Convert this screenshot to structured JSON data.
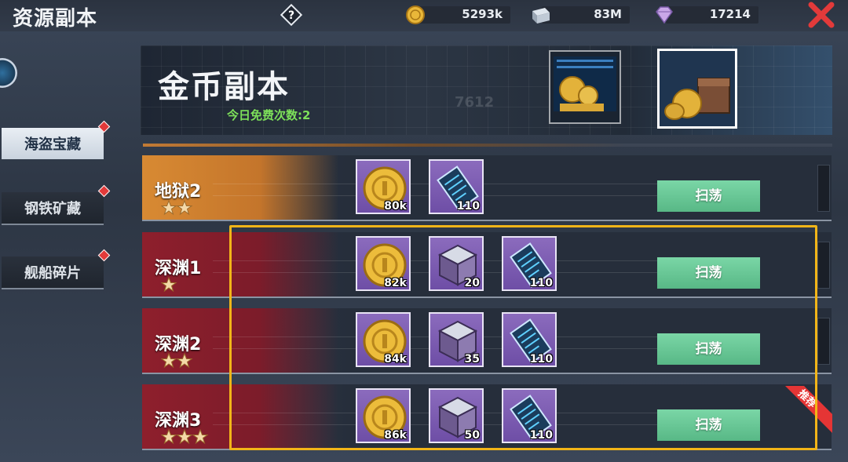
{
  "header": {
    "title": "资源副本",
    "help_icon": "question-diamond-icon",
    "resources": [
      {
        "icon": "gold-coin-icon",
        "value": "5293k"
      },
      {
        "icon": "steel-ingot-icon",
        "value": "83M"
      },
      {
        "icon": "diamond-icon",
        "value": "17214"
      }
    ],
    "close_icon": "close-x-icon"
  },
  "sidebar": {
    "tabs": [
      {
        "label": "海盗宝藏",
        "active": true,
        "has_notice": true
      },
      {
        "label": "钢铁矿藏",
        "active": false,
        "has_notice": true
      },
      {
        "label": "舰船碎片",
        "active": false,
        "has_notice": true
      }
    ]
  },
  "banner": {
    "title": "金币副本",
    "free_runs": "今日免费次数:2",
    "deco_number": "7612"
  },
  "levels": [
    {
      "name": "地狱2",
      "stars": 2,
      "theme": "gold",
      "sweep_label": "扫荡",
      "rewards": [
        {
          "type": "gold-coin",
          "count": "80k"
        },
        {
          "type": "blueprint-card",
          "count": "110"
        }
      ]
    },
    {
      "name": "深渊1",
      "stars": 1,
      "theme": "red",
      "sweep_label": "扫荡",
      "rewards": [
        {
          "type": "gold-coin",
          "count": "82k"
        },
        {
          "type": "metal-cube",
          "count": "20"
        },
        {
          "type": "blueprint-card",
          "count": "110"
        }
      ]
    },
    {
      "name": "深渊2",
      "stars": 2,
      "theme": "red",
      "sweep_label": "扫荡",
      "rewards": [
        {
          "type": "gold-coin",
          "count": "84k"
        },
        {
          "type": "metal-cube",
          "count": "35"
        },
        {
          "type": "blueprint-card",
          "count": "110"
        }
      ]
    },
    {
      "name": "深渊3",
      "stars": 3,
      "theme": "red",
      "sweep_label": "扫荡",
      "recommended": true,
      "rewards": [
        {
          "type": "gold-coin",
          "count": "86k"
        },
        {
          "type": "metal-cube",
          "count": "50"
        },
        {
          "type": "blueprint-card",
          "count": "110"
        }
      ]
    }
  ],
  "recommend_label": "推荐",
  "colors": {
    "highlight": "#f2b518",
    "sweep": "#6cc898",
    "notice": "#e23a3a",
    "free_runs": "#7de05a"
  }
}
